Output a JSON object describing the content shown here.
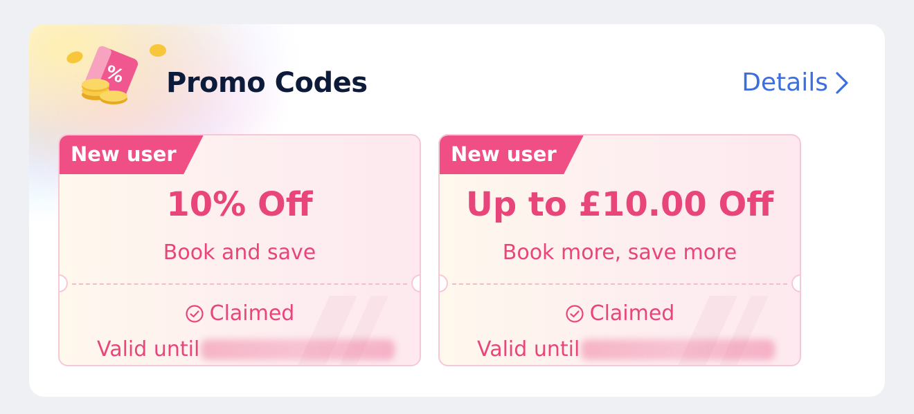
{
  "header": {
    "title": "Promo Codes",
    "details_label": "Details"
  },
  "coupons": [
    {
      "badge": "New user",
      "amount": "10% Off",
      "subtitle": "Book and save",
      "status": "Claimed",
      "valid_label": "Valid until"
    },
    {
      "badge": "New user",
      "amount": "Up to £10.00 Off",
      "subtitle": "Book more, save more",
      "status": "Claimed",
      "valid_label": "Valid until"
    }
  ],
  "colors": {
    "accent_pink": "#e8457a",
    "badge_pink": "#ef4f85",
    "link_blue": "#3b6fdf",
    "title_navy": "#0d1b3a"
  },
  "icons": {
    "header": "promo-ticket-coins-icon",
    "details": "chevron-right-icon",
    "status": "check-circle-icon"
  }
}
